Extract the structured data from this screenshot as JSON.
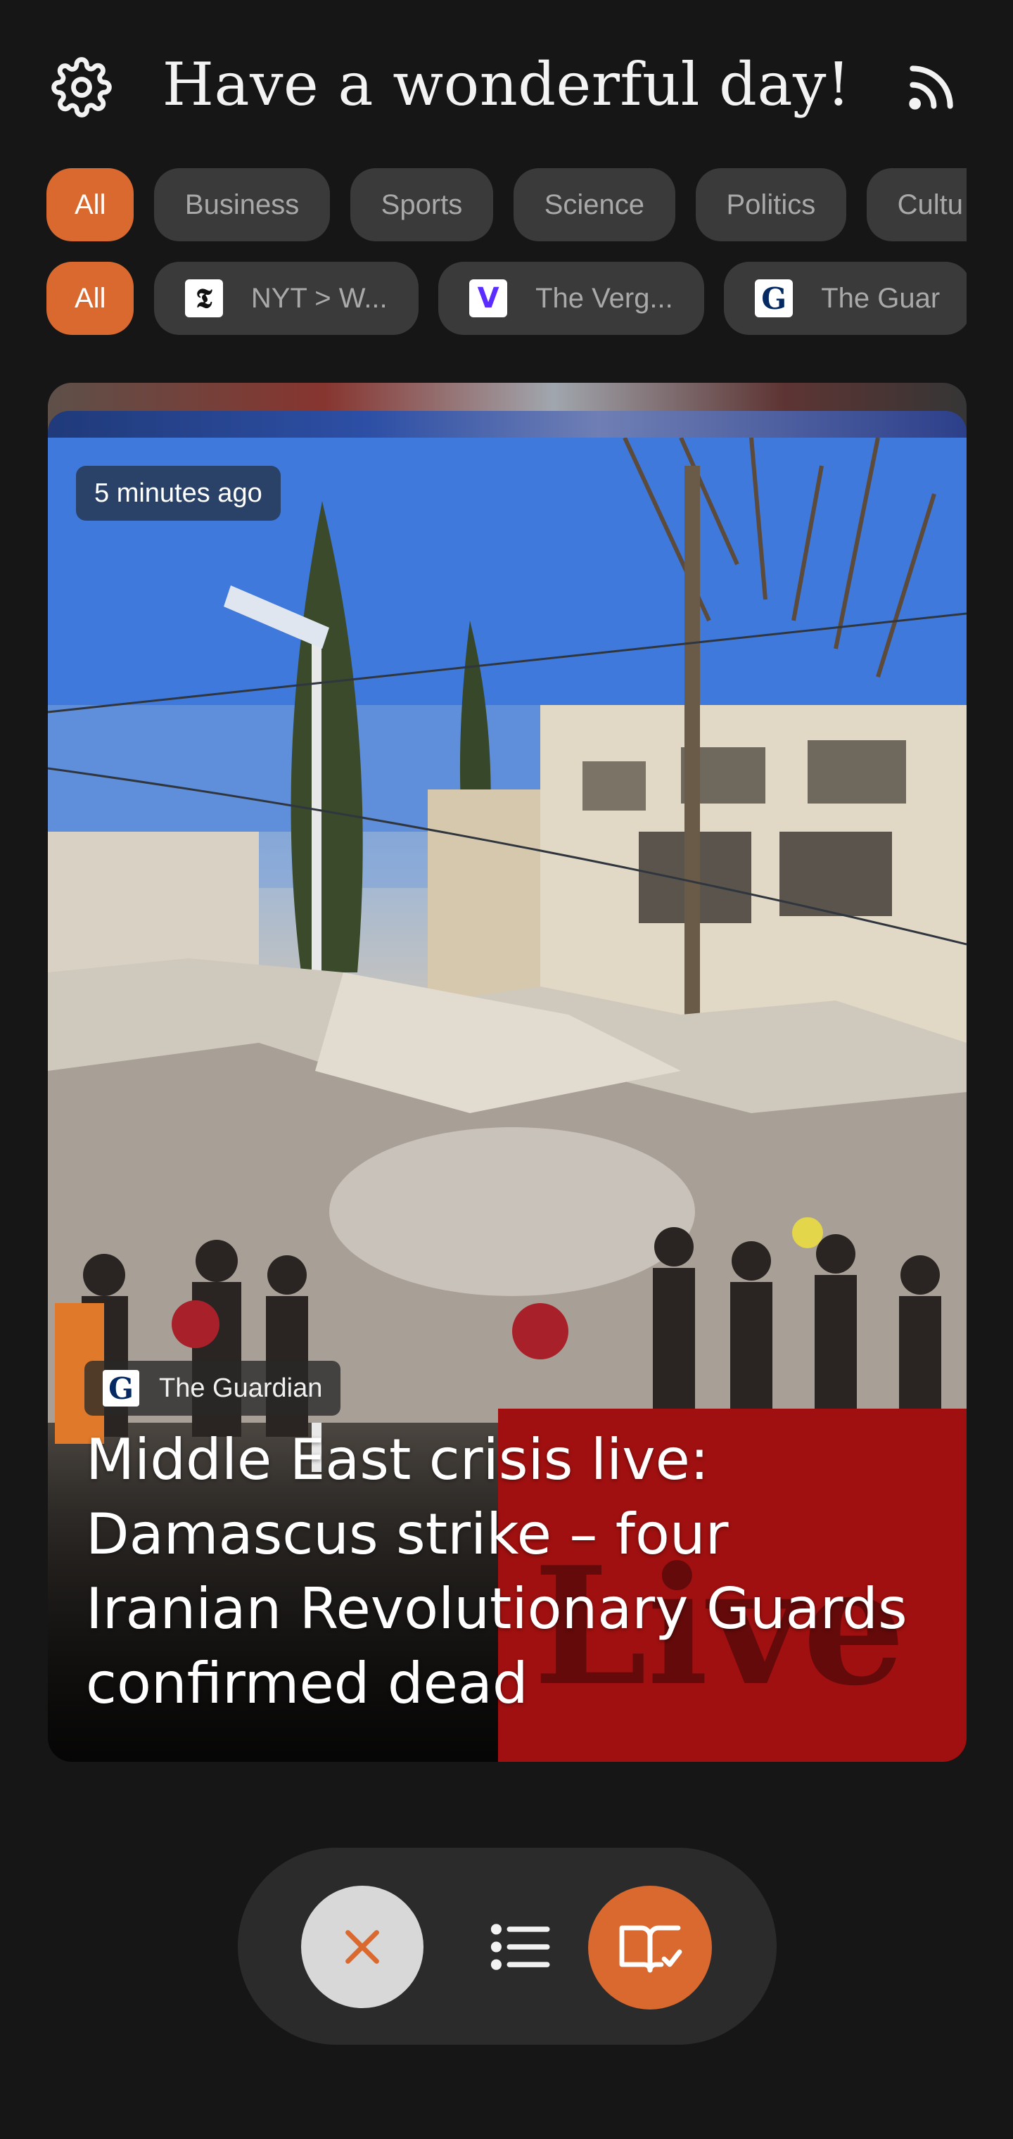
{
  "header": {
    "title": "Have a wonderful day!",
    "settings_icon": "gear-icon",
    "rss_icon": "rss-icon"
  },
  "categories": [
    {
      "label": "All",
      "active": true
    },
    {
      "label": "Business",
      "active": false
    },
    {
      "label": "Sports",
      "active": false
    },
    {
      "label": "Science",
      "active": false
    },
    {
      "label": "Politics",
      "active": false
    },
    {
      "label": "Cultu",
      "active": false
    }
  ],
  "sources": [
    {
      "label": "All",
      "active": true,
      "icon": ""
    },
    {
      "label": "NYT > W...",
      "active": false,
      "icon": "nyt-icon"
    },
    {
      "label": "The Verg...",
      "active": false,
      "icon": "verge-icon"
    },
    {
      "label": "The Guar",
      "active": false,
      "icon": "guardian-icon"
    }
  ],
  "card": {
    "time": "5 minutes ago",
    "source": "The Guardian",
    "headline": "Middle East crisis live: Damascus strike – four Iranian Revolutionary Guards confirmed dead",
    "image_overlay_text": "Live G"
  },
  "bottom_bar": {
    "dismiss_icon": "close-icon",
    "list_icon": "list-icon",
    "read_icon": "book-check-icon"
  },
  "colors": {
    "accent": "#d9692f",
    "background": "#161616",
    "chip": "#3a3a3a"
  }
}
